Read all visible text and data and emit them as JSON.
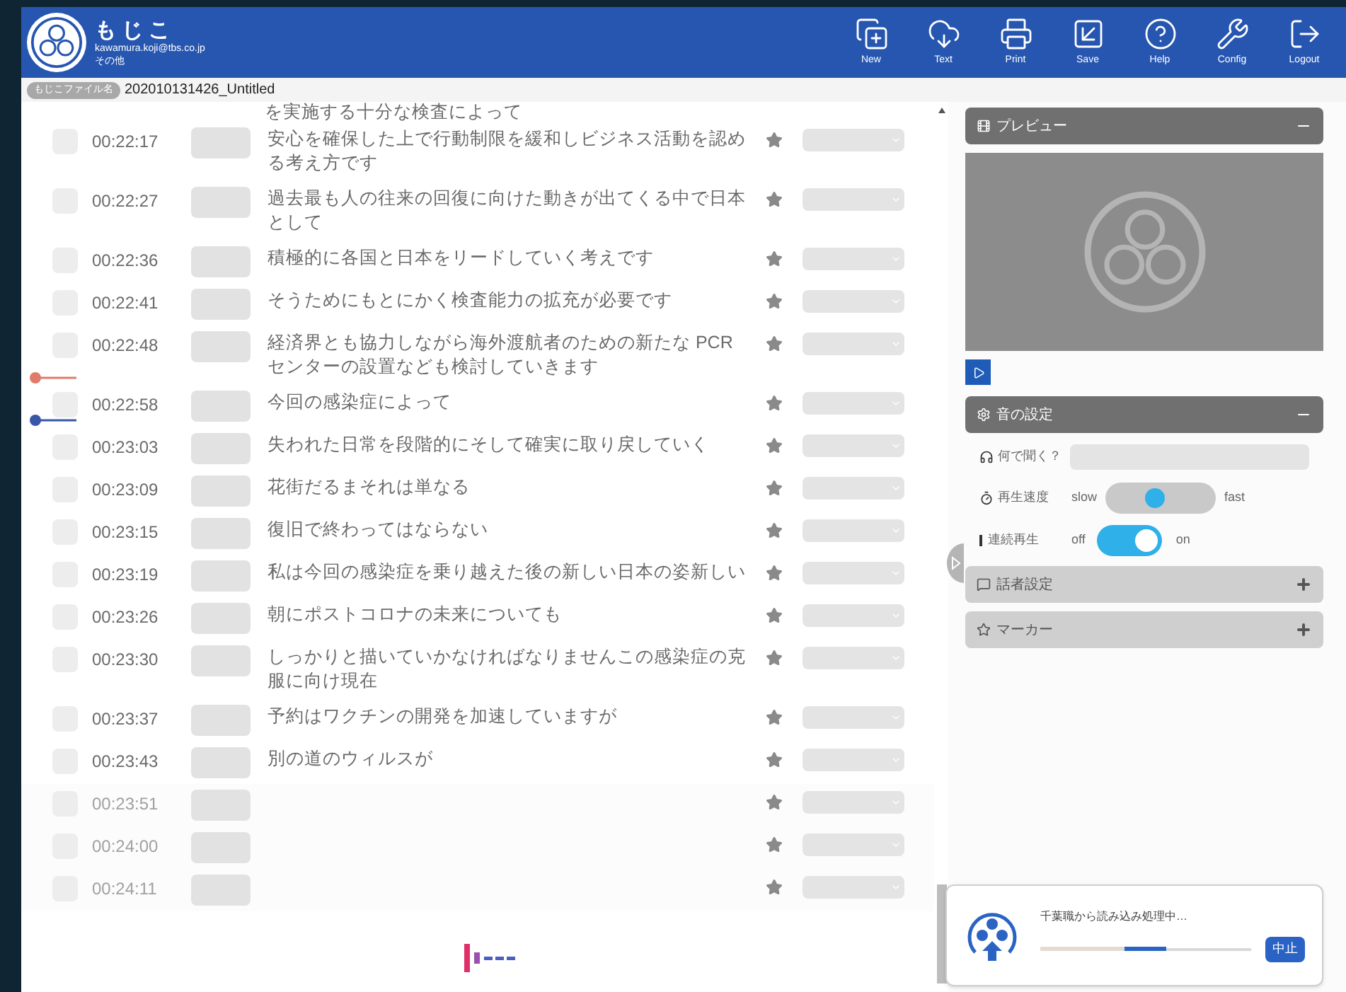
{
  "header": {
    "title": "もじこ",
    "email": "kawamura.koji@tbs.co.jp",
    "subtitle": "その他",
    "toolbar": [
      {
        "kind": "new",
        "label": "New"
      },
      {
        "kind": "text",
        "label": "Text"
      },
      {
        "kind": "print",
        "label": "Print"
      },
      {
        "kind": "save",
        "label": "Save"
      },
      {
        "kind": "help",
        "label": "Help"
      },
      {
        "kind": "config",
        "label": "Config"
      },
      {
        "kind": "logout",
        "label": "Logout"
      }
    ]
  },
  "file": {
    "tag": "もじこファイル名",
    "name": "202010131426_Untitled"
  },
  "transcript": {
    "partial_line": "を実施する十分な検査によって",
    "rows": [
      {
        "time": "00:22:17",
        "text": "安心を確保した上で行動制限を緩和しビジネス活動を認める考え方です",
        "faded": false
      },
      {
        "time": "00:22:27",
        "text": "過去最も人の往来の回復に向けた動きが出てくる中で日本として",
        "faded": false
      },
      {
        "time": "00:22:36",
        "text": "積極的に各国と日本をリードしていく考えです",
        "faded": false
      },
      {
        "time": "00:22:41",
        "text": "そうためにもとにかく検査能力の拡充が必要です",
        "faded": false
      },
      {
        "time": "00:22:48",
        "text": "経済界とも協力しながら海外渡航者のための新たな PCR センターの設置なども検討していきます",
        "faded": false
      },
      {
        "time": "00:22:58",
        "text": "今回の感染症によって",
        "faded": false,
        "marker": {
          "color": "#e07a6a"
        }
      },
      {
        "time": "00:23:03",
        "text": "失われた日常を段階的にそして確実に取り戻していく",
        "faded": false,
        "marker": {
          "color": "#3a56a8"
        }
      },
      {
        "time": "00:23:09",
        "text": "花街だるまそれは単なる",
        "faded": false
      },
      {
        "time": "00:23:15",
        "text": "復旧で終わってはならない",
        "faded": false
      },
      {
        "time": "00:23:19",
        "text": "私は今回の感染症を乗り越えた後の新しい日本の姿新しい",
        "faded": false
      },
      {
        "time": "00:23:26",
        "text": "朝にポストコロナの未来についても",
        "faded": false
      },
      {
        "time": "00:23:30",
        "text": "しっかりと描いていかなければなりませんこの感染症の克服に向け現在",
        "faded": false
      },
      {
        "time": "00:23:37",
        "text": "予約はワクチンの開発を加速していますが",
        "faded": false
      },
      {
        "time": "00:23:43",
        "text": "別の道のウィルスが",
        "faded": false
      },
      {
        "time": "00:23:51",
        "faded": true
      },
      {
        "time": "00:24:00",
        "faded": true
      },
      {
        "time": "00:24:11",
        "faded": true
      }
    ]
  },
  "preview": {
    "title": "プレビュー",
    "expanded": true
  },
  "sound": {
    "title": "音の設定",
    "expanded": true,
    "listen_label": "何で聞く？",
    "speed_label": "再生速度",
    "slow": "slow",
    "fast": "fast",
    "speed": {
      "level": 0.45
    },
    "continuous_label": "連続再生",
    "off": "off",
    "on_label": "on",
    "continuous": {
      "on": true
    }
  },
  "sections": [
    {
      "kind": "speaker",
      "title": "話者設定",
      "expanded": false
    },
    {
      "kind": "marker",
      "title": "マーカー",
      "expanded": false
    }
  ],
  "dialog": {
    "message": "千葉職から読み込み処理中…",
    "progress": {
      "level": 0.6
    },
    "button": "中止"
  }
}
